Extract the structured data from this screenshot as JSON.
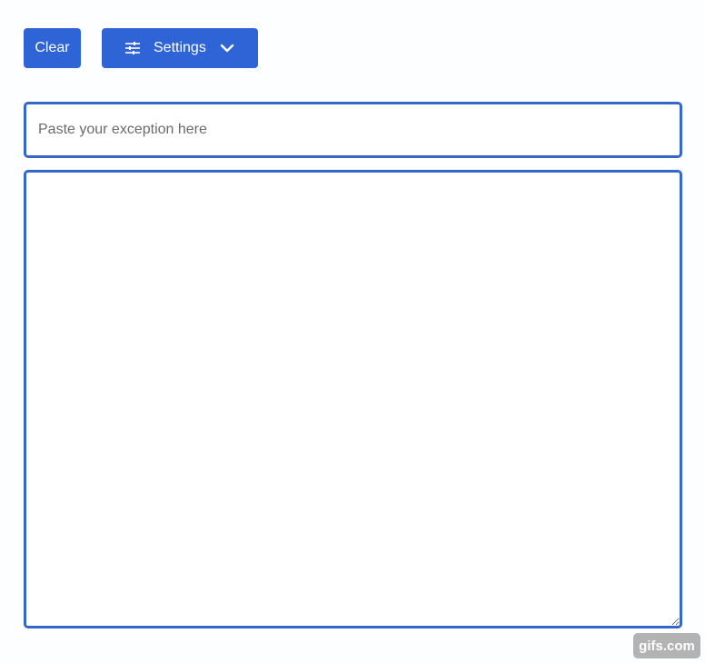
{
  "toolbar": {
    "clear_label": "Clear",
    "settings_label": "Settings",
    "settings_icon": "sliders-icon",
    "settings_chevron_icon": "chevron-down-icon"
  },
  "exception_input": {
    "placeholder": "Paste your exception here",
    "value": ""
  },
  "output": {
    "value": ""
  },
  "watermark": {
    "text": "gifs.com"
  },
  "colors": {
    "accent": "#2f64d6",
    "border": "#3566c9",
    "background": "#fdfeff"
  }
}
